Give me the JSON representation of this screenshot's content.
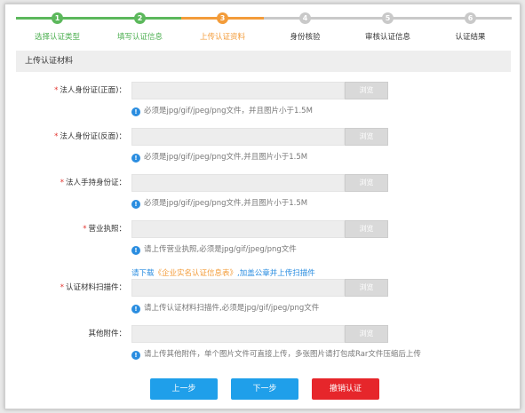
{
  "steps": [
    {
      "num": "1",
      "label": "选择认证类型",
      "state": "done"
    },
    {
      "num": "2",
      "label": "填写认证信息",
      "state": "done"
    },
    {
      "num": "3",
      "label": "上传认证资料",
      "state": "active"
    },
    {
      "num": "4",
      "label": "身份核验",
      "state": "todo"
    },
    {
      "num": "5",
      "label": "审核认证信息",
      "state": "todo"
    },
    {
      "num": "6",
      "label": "认证结果",
      "state": "todo"
    }
  ],
  "section_title": "上传认证材料",
  "fields": {
    "id_front": {
      "required": "*",
      "label": "法人身份证(正面)：",
      "browse": "浏览",
      "hint": "必须是jpg/gif/jpeg/png文件，并且图片小于1.5M"
    },
    "id_back": {
      "required": "*",
      "label": "法人身份证(反面)：",
      "browse": "浏览",
      "hint": "必须是jpg/gif/jpeg/png文件,并且图片小于1.5M"
    },
    "id_hand": {
      "required": "*",
      "label": "法人手持身份证：",
      "browse": "浏览",
      "hint": "必须是jpg/gif/jpeg/png文件,并且图片小于1.5M"
    },
    "license": {
      "required": "*",
      "label": "营业执照：",
      "browse": "浏览",
      "hint": "请上传营业执照,必须是jpg/gif/jpeg/png文件"
    },
    "scan": {
      "required": "*",
      "label": "认证材料扫描件：",
      "browse": "浏览",
      "hint": "请上传认证材料扫描件,必须是jpg/gif/jpeg/png文件"
    },
    "other": {
      "required": "",
      "label": "其他附件：",
      "browse": "浏览",
      "hint": "请上传其他附件，单个图片文件可直接上传，多张图片请打包成Rar文件压缩后上传"
    }
  },
  "download_note": {
    "prefix": "请下载",
    "link": "《企业实名认证信息表》",
    "suffix": ",加盖公章并上传扫描件"
  },
  "buttons": {
    "prev": "上一步",
    "next": "下一步",
    "cancel": "撤销认证"
  },
  "colors": {
    "done": "#5cb85c",
    "active": "#f39c3a",
    "todo": "#c9c9c9",
    "primary": "#1f9fea",
    "danger": "#e6262b"
  }
}
